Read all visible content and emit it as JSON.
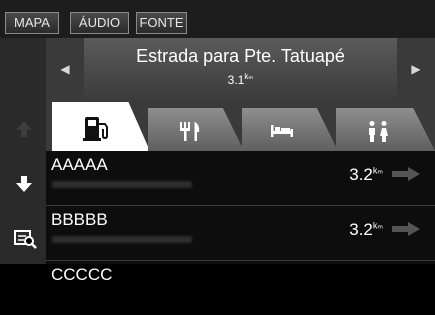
{
  "topbar": {
    "buttons": [
      "MAPA",
      "ÁUDIO",
      "FONTE"
    ]
  },
  "header": {
    "title": "Estrada para Pte. Tatuapé",
    "distance": "3.1",
    "distance_unit": "kₘ",
    "prev_icon": "triangle-left-icon",
    "next_icon": "triangle-right-icon"
  },
  "tabs": [
    {
      "icon": "gas-station-icon",
      "active": true
    },
    {
      "icon": "restaurant-icon",
      "active": false
    },
    {
      "icon": "lodging-icon",
      "active": false
    },
    {
      "icon": "restroom-icon",
      "active": false
    }
  ],
  "sidebar": {
    "icons": [
      "scroll-up-icon",
      "scroll-down-icon",
      "search-list-icon"
    ]
  },
  "list": [
    {
      "name": "AAAAA",
      "distance": "3.2",
      "unit": "kₘ"
    },
    {
      "name": "BBBBB",
      "distance": "3.2",
      "unit": "kₘ"
    },
    {
      "name": "CCCCC"
    }
  ],
  "colors": {
    "background": "#000000",
    "active_tab": "#ffffff",
    "inactive_tab": "#7a7a7a"
  }
}
